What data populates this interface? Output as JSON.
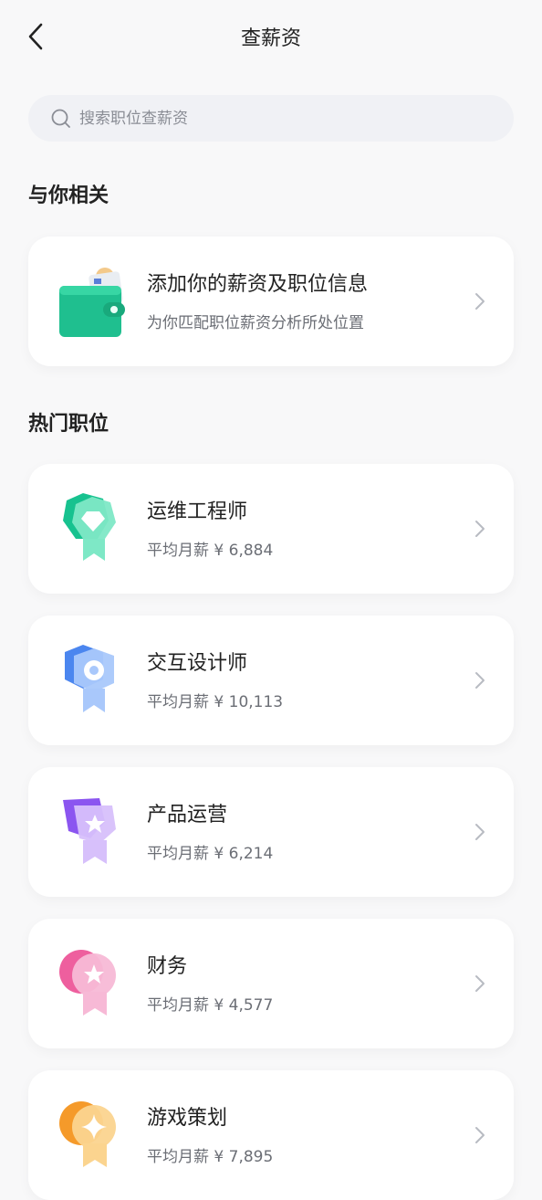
{
  "header": {
    "title": "查薪资"
  },
  "search": {
    "placeholder": "搜索职位查薪资"
  },
  "related": {
    "section_title": "与你相关",
    "card": {
      "title": "添加你的薪资及职位信息",
      "subtitle": "为你匹配职位薪资分析所处位置",
      "icon": "wallet-icon"
    }
  },
  "hot": {
    "section_title": "热门职位",
    "items": [
      {
        "name": "运维工程师",
        "salary": "平均月薪 ¥ 6,884",
        "icon": "diamond-badge-icon",
        "color": "#2fd6a3"
      },
      {
        "name": "交互设计师",
        "salary": "平均月薪 ¥ 10,113",
        "icon": "gear-badge-icon",
        "color": "#4f8cf0"
      },
      {
        "name": "产品运营",
        "salary": "平均月薪 ¥ 6,214",
        "icon": "star6-badge-icon",
        "color": "#9b66f2"
      },
      {
        "name": "财务",
        "salary": "平均月薪 ¥ 4,577",
        "icon": "star-badge-icon",
        "color": "#f277b2"
      },
      {
        "name": "游戏策划",
        "salary": "平均月薪 ¥ 7,895",
        "icon": "sparkle-badge-icon",
        "color": "#f7a83c"
      }
    ]
  }
}
